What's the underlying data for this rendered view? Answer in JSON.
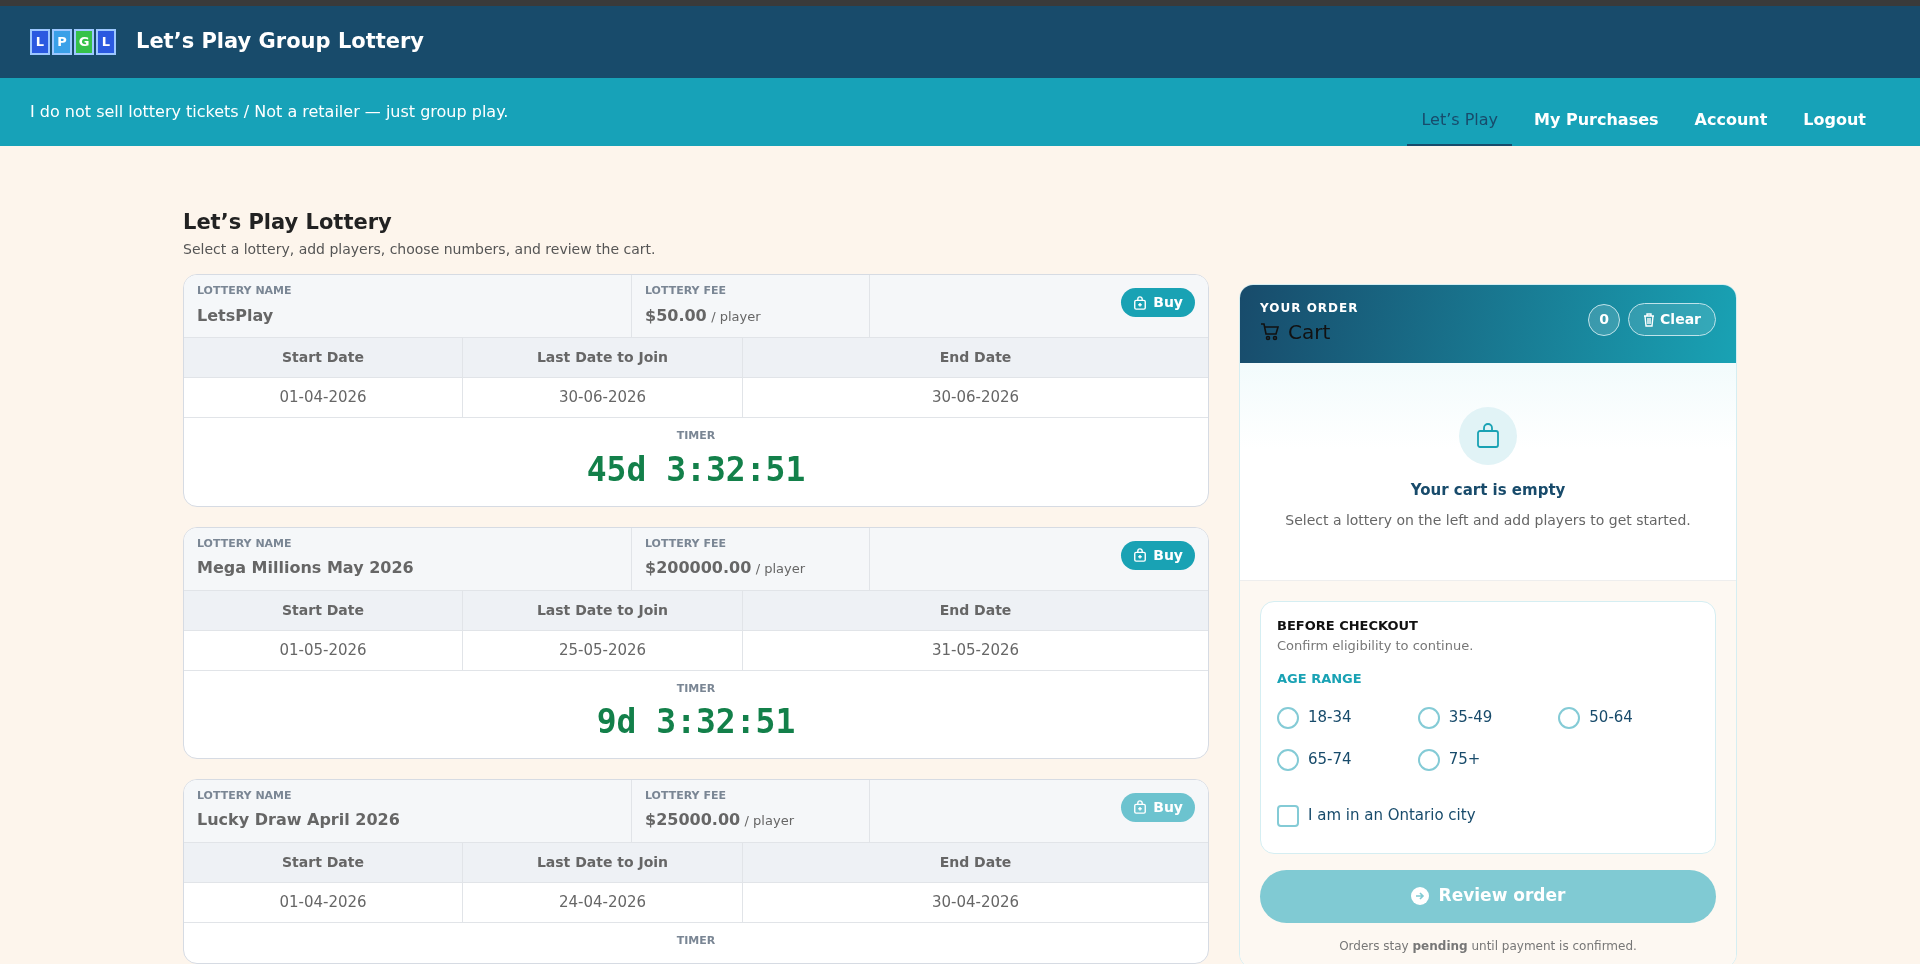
{
  "header": {
    "logo_tiles": [
      {
        "letter": "L",
        "color": "#2b59e0"
      },
      {
        "letter": "P",
        "color": "#3aa0e8"
      },
      {
        "letter": "G",
        "color": "#35c24a"
      },
      {
        "letter": "L",
        "color": "#2b59e0"
      }
    ],
    "title": "Let’s Play Group Lottery"
  },
  "subbar": {
    "notice": "I do not sell lottery tickets / Not a retailer — just group play.",
    "nav": [
      {
        "label": "Let’s Play",
        "selected": true
      },
      {
        "label": "My Purchases",
        "selected": false
      },
      {
        "label": "Account",
        "selected": false
      },
      {
        "label": "Logout",
        "selected": false
      }
    ]
  },
  "page": {
    "title": "Let’s Play Lottery",
    "subtitle": "Select a lottery, add players, choose numbers, and review the cart."
  },
  "lotteries": [
    {
      "name_label": "LOTTERY NAME",
      "name": "LetsPlay",
      "fee_label": "LOTTERY FEE",
      "fee": "$50.00",
      "fee_unit": "/ player",
      "buy": {
        "label": "Buy",
        "disabled": false
      },
      "date_columns": [
        "Start Date",
        "Last Date to Join",
        "End Date"
      ],
      "dates": [
        "01-04-2026",
        "30-06-2026",
        "30-06-2026"
      ],
      "timer_label": "TIMER",
      "timer": {
        "value": "45d 3:32:51",
        "closed": false
      }
    },
    {
      "name_label": "LOTTERY NAME",
      "name": "Mega Millions May 2026",
      "fee_label": "LOTTERY FEE",
      "fee": "$200000.00",
      "fee_unit": "/ player",
      "buy": {
        "label": "Buy",
        "disabled": false
      },
      "date_columns": [
        "Start Date",
        "Last Date to Join",
        "End Date"
      ],
      "dates": [
        "01-05-2026",
        "25-05-2026",
        "31-05-2026"
      ],
      "timer_label": "TIMER",
      "timer": {
        "value": "9d 3:32:51",
        "closed": false
      }
    },
    {
      "name_label": "LOTTERY NAME",
      "name": "Lucky Draw April 2026",
      "fee_label": "LOTTERY FEE",
      "fee": "$25000.00",
      "fee_unit": "/ player",
      "buy": {
        "label": "Buy",
        "disabled": true
      },
      "date_columns": [
        "Start Date",
        "Last Date to Join",
        "End Date"
      ],
      "dates": [
        "01-04-2026",
        "24-04-2026",
        "30-04-2026"
      ],
      "timer_label": "TIMER"
    }
  ],
  "cart": {
    "eyebrow": "YOUR ORDER",
    "title": "Cart",
    "count": "0",
    "clear_label": "Clear",
    "empty_title": "Your cart is empty",
    "empty_text": "Select a lottery on the left and add players to get started."
  },
  "checkout": {
    "title": "BEFORE CHECKOUT",
    "subtitle": "Confirm eligibility to continue.",
    "age_label": "AGE RANGE",
    "age_options": [
      {
        "label": "18-34",
        "selected": false
      },
      {
        "label": "35-49",
        "selected": false
      },
      {
        "label": "50-64",
        "selected": false
      },
      {
        "label": "65-74",
        "selected": false
      },
      {
        "label": "75+",
        "selected": false
      }
    ],
    "ontario": {
      "label": "I am in an Ontario city",
      "checked": false
    }
  },
  "review": {
    "label": "Review order",
    "disabled": true
  },
  "note": "Orders stay **pending** until payment is confirmed."
}
